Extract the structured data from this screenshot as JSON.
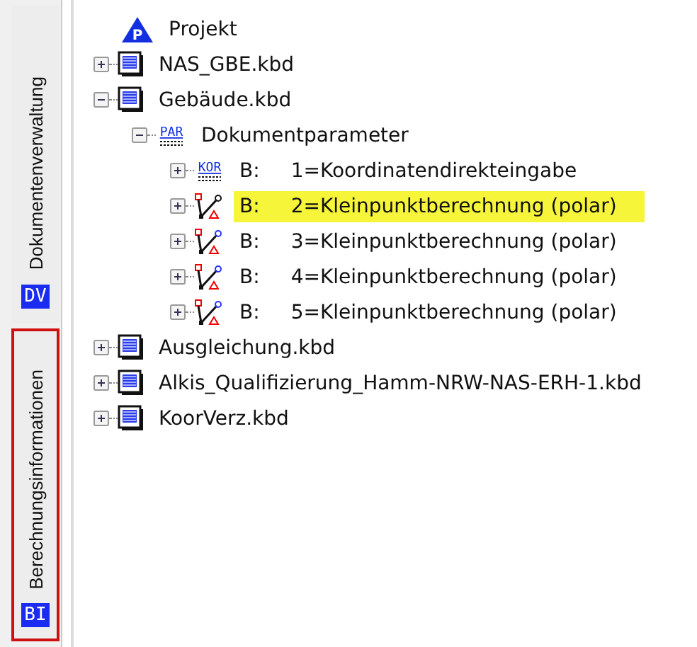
{
  "side_tabs": [
    {
      "label": "Dokumentenverwaltung",
      "badge": "DV",
      "highlighted": false
    },
    {
      "label": "Berechnungsinformationen",
      "badge": "BI",
      "highlighted": true
    }
  ],
  "tree": [
    {
      "kind": "project",
      "badge": "P",
      "label": "Projekt",
      "selected": false,
      "children": [
        {
          "kind": "file",
          "label": "NAS_GBE.kbd",
          "expanded": false,
          "selected": false
        },
        {
          "kind": "file",
          "label": "Gebäude.kbd",
          "expanded": true,
          "selected": false,
          "children": [
            {
              "kind": "param",
              "badge": "PAR",
              "label": "Dokumentparameter",
              "expanded": true,
              "selected": false,
              "children": [
                {
                  "kind": "coord",
                  "badge": "KOR",
                  "prefix": "B:",
                  "label": "1=Koordinatendirekteingabe",
                  "expanded": false,
                  "selected": false
                },
                {
                  "kind": "calc",
                  "prefix": "B:",
                  "label": "2=Kleinpunktberechnung (polar)",
                  "expanded": false,
                  "selected": true
                },
                {
                  "kind": "calc",
                  "prefix": "B:",
                  "label": "3=Kleinpunktberechnung (polar)",
                  "expanded": false,
                  "selected": false
                },
                {
                  "kind": "calc",
                  "prefix": "B:",
                  "label": "4=Kleinpunktberechnung (polar)",
                  "expanded": false,
                  "selected": false
                },
                {
                  "kind": "calc",
                  "prefix": "B:",
                  "label": "5=Kleinpunktberechnung (polar)",
                  "expanded": false,
                  "selected": false
                }
              ]
            }
          ]
        },
        {
          "kind": "file",
          "label": "Ausgleichung.kbd",
          "expanded": false,
          "selected": false
        },
        {
          "kind": "file",
          "label": "Alkis_Qualifizierung_Hamm-NRW-NAS-ERH-1.kbd",
          "expanded": false,
          "selected": false
        },
        {
          "kind": "file",
          "label": "KoorVerz.kbd",
          "expanded": false,
          "selected": false
        }
      ]
    }
  ]
}
